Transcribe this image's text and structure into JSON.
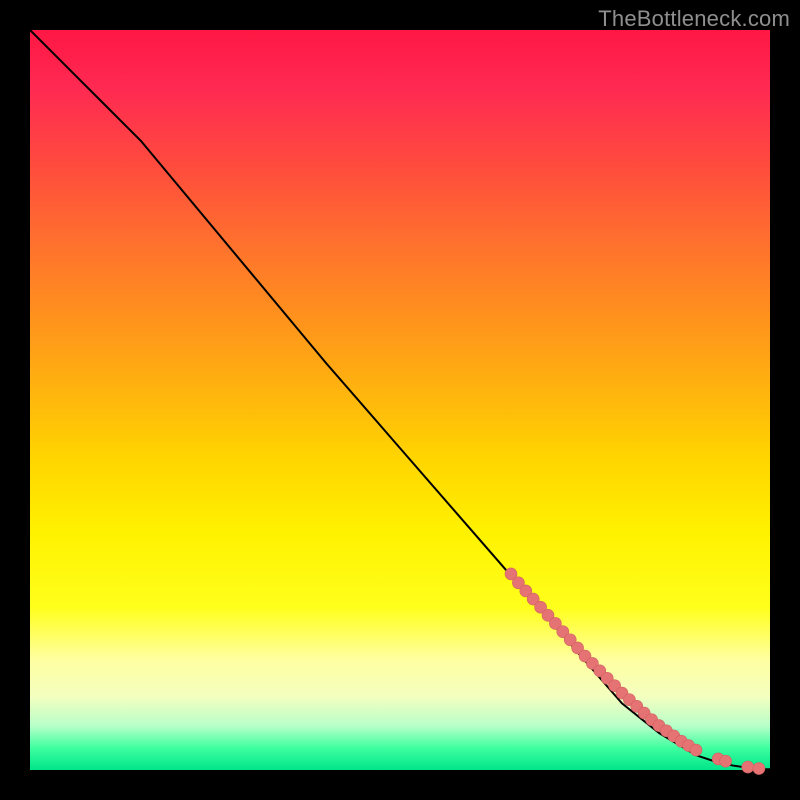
{
  "watermark": "TheBottleneck.com",
  "chart_data": {
    "type": "line",
    "title": "",
    "xlabel": "",
    "ylabel": "",
    "xlim": [
      0,
      100
    ],
    "ylim": [
      0,
      100
    ],
    "grid": false,
    "legend": false,
    "series": [
      {
        "name": "curve",
        "x": [
          0,
          3,
          6,
          10,
          15,
          20,
          30,
          40,
          50,
          60,
          70,
          80,
          85,
          90,
          93,
          95,
          97,
          98,
          99,
          100
        ],
        "y": [
          100,
          97,
          94,
          90,
          85,
          79,
          67,
          55,
          43.5,
          32,
          20.5,
          9,
          5,
          2,
          1,
          0.6,
          0.3,
          0.2,
          0.1,
          0.1
        ]
      }
    ],
    "markers": {
      "name": "beads",
      "x": [
        65,
        66,
        67,
        68,
        69,
        70,
        71,
        72,
        73,
        74,
        75,
        76,
        77,
        78,
        79,
        80,
        81,
        82,
        83,
        84,
        85,
        86,
        87,
        88,
        89,
        90,
        93,
        94,
        97,
        98.5
      ],
      "y": [
        26.5,
        25.3,
        24.2,
        23.1,
        22.0,
        20.9,
        19.8,
        18.7,
        17.6,
        16.5,
        15.4,
        14.4,
        13.4,
        12.4,
        11.4,
        10.4,
        9.5,
        8.6,
        7.7,
        6.8,
        6.0,
        5.3,
        4.6,
        3.9,
        3.3,
        2.7,
        1.5,
        1.2,
        0.4,
        0.2
      ],
      "r": 6
    }
  },
  "colors": {
    "marker_fill": "#e57373",
    "marker_stroke": "#d16060",
    "curve_stroke": "#000000"
  }
}
